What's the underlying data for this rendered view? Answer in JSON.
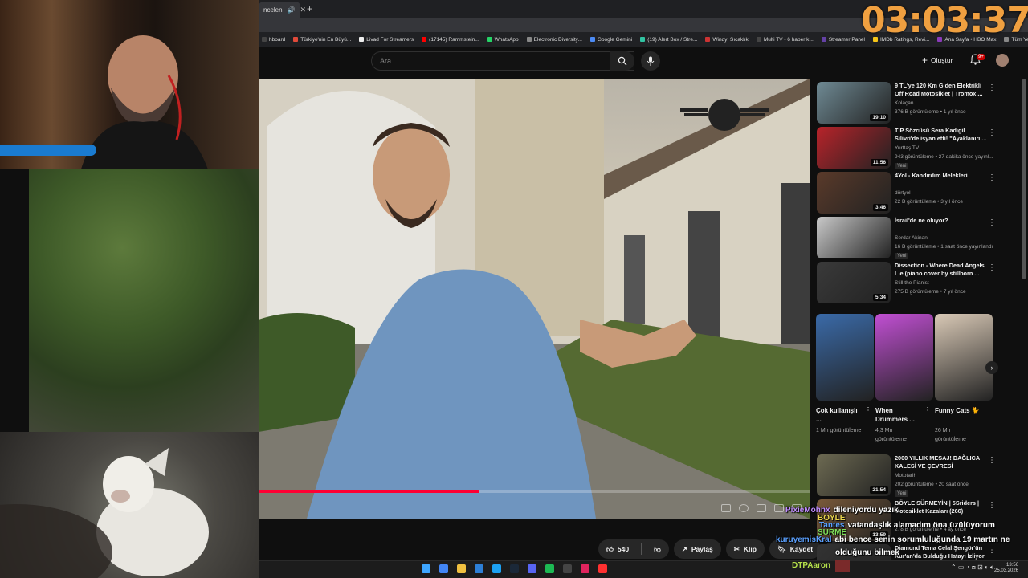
{
  "overlay": {
    "timer": "03:03:37",
    "streamer_tag": "DTPAaron"
  },
  "browser": {
    "active_tab_title": "ncelen",
    "bookmarks": [
      {
        "label": "hboard",
        "color": "#444"
      },
      {
        "label": "Türkiye'nin En Büyü...",
        "color": "#e04a3a"
      },
      {
        "label": "Livad For Streamers",
        "color": "#eee"
      },
      {
        "label": "(17145) Rammstein...",
        "color": "#ff0000"
      },
      {
        "label": "WhatsApp",
        "color": "#25d366"
      },
      {
        "label": "Electronic Diversity...",
        "color": "#888"
      },
      {
        "label": "Google Gemini",
        "color": "#4c8bf5"
      },
      {
        "label": "(19) Alert Box / Stre...",
        "color": "#31c3a2"
      },
      {
        "label": "Windy: Sıcaklık",
        "color": "#c33"
      },
      {
        "label": "Multi TV - 6 haber k...",
        "color": "#444"
      },
      {
        "label": "Streamer Panel",
        "color": "#6441a5"
      },
      {
        "label": "IMDb Ratings, Revi...",
        "color": "#f5c518"
      },
      {
        "label": "Ana Sayfa • HBO Max",
        "color": "#8a3ab9"
      },
      {
        "label": "Tüm Yer İşaretleri",
        "color": "#888"
      }
    ]
  },
  "youtube": {
    "search_placeholder": "Ara",
    "create_label": "Oluştur",
    "notifications_badge": "9+",
    "actions": {
      "like_count": "540",
      "share": "Paylaş",
      "clip": "Klip",
      "save": "Kaydet"
    },
    "video_progress": 0.4
  },
  "sidebar": {
    "recommendations": [
      {
        "title": "9 TL'ye 120 Km Giden Elektrikli Off Road Motosiklet | Tromox ...",
        "channel": "Kolaçan",
        "meta": "376 B görüntüleme • 1 yıl önce",
        "duration": "19:10",
        "thumb": "#6f8a94",
        "badge": ""
      },
      {
        "title": "TİP Sözcüsü Sera Kadıgil Silivri'de isyan etti! \"Ayaklanırı ...",
        "channel": "Yurttaş TV",
        "meta": "943 görüntüleme • 27 dakika önce yayınl...",
        "duration": "11:56",
        "thumb": "#b8232a",
        "badge": "Yeni"
      },
      {
        "title": "4Yol - Kandırdım Melekleri",
        "channel": "dörtyol",
        "meta": "22 B görüntüleme • 3 yıl önce",
        "duration": "3:46",
        "thumb": "#5a3a2a",
        "badge": ""
      },
      {
        "title": "İsrail'de ne oluyor?",
        "channel": "Serdar Akinan",
        "meta": "16 B görüntüleme • 1 saat önce yayınlandı",
        "duration": "",
        "thumb": "#c9c9c9",
        "badge": "Yeni"
      },
      {
        "title": "Dissection - Where Dead Angels Lie (piano cover by stillborn ...",
        "channel": "Still the Pianist",
        "meta": "275 B görüntüleme • 7 yıl önce",
        "duration": "5:34",
        "thumb": "#3a3a3a",
        "badge": ""
      }
    ],
    "shorts": [
      {
        "title": "Çok kullanışlı ...",
        "views": "1 Mn görüntüleme",
        "thumb": "#3a6aa8"
      },
      {
        "title": "When Drummers ...",
        "views": "4,3 Mn görüntüleme",
        "thumb": "#c14fd3"
      },
      {
        "title": "Funny Cats 🐈",
        "views": "26 Mn görüntüleme",
        "thumb": "#d9c9b6"
      }
    ],
    "more": [
      {
        "title": "2000 YILLIK MESAJ! DAĞLICA KALESİ VE ÇEVRESİ",
        "channel": "Mototarih",
        "meta": "202 görüntüleme • 20 saat önce",
        "duration": "21:54",
        "thumb": "#6d6a52",
        "badge": "Yeni"
      },
      {
        "title": "BÖYLE SÜRMEYİN | 5Sriders | Motosiklet Kazaları (266)",
        "channel": "",
        "meta": "278 B görüntüleme • 4 ay önce",
        "duration": "13:59",
        "thumb": "#7a5a3a",
        "badge": ""
      },
      {
        "title": "Diamond Tema Celal Şengör'ün Kur'an'da Bulduğu Hatayı İzliyor",
        "channel": "",
        "meta": "",
        "duration": "",
        "thumb": "#333",
        "badge": ""
      }
    ]
  },
  "chat": [
    {
      "user": "PixieMohnx",
      "user_color": "#c08cff",
      "text": "dileniyordu yazık",
      "text_color": "#ffffff"
    },
    {
      "user": "BOYLE",
      "user_color": "#e8d44d",
      "text": "",
      "text_color": "#ffffff"
    },
    {
      "user": "Tantes",
      "user_color": "#5aa0ff",
      "text": "vatandaşlık alamadım öna üzülüyorum",
      "text_color": "#ffffff"
    },
    {
      "user": "SURME",
      "user_color": "#7ee05a",
      "text": "",
      "text_color": "#ffffff"
    },
    {
      "user": "kuruyemisKral",
      "user_color": "#5aa0ff",
      "text": "abi bence senin sorumluluğunda 19 martın ne",
      "text_color": "#ffffff"
    },
    {
      "user": "",
      "user_color": "#ffffff",
      "text": "olduğunu bilmek",
      "text_color": "#ffffff"
    }
  ],
  "taskbar": {
    "time": "13:56",
    "date": "25.03.2026",
    "icons": [
      "#3ea6ff",
      "#4285f4",
      "#f0c040",
      "#2d7fd6",
      "#1da1f2",
      "#1b2838",
      "#5865f2",
      "#1db954",
      "#444",
      "#e0245e",
      "#ff3030"
    ]
  }
}
